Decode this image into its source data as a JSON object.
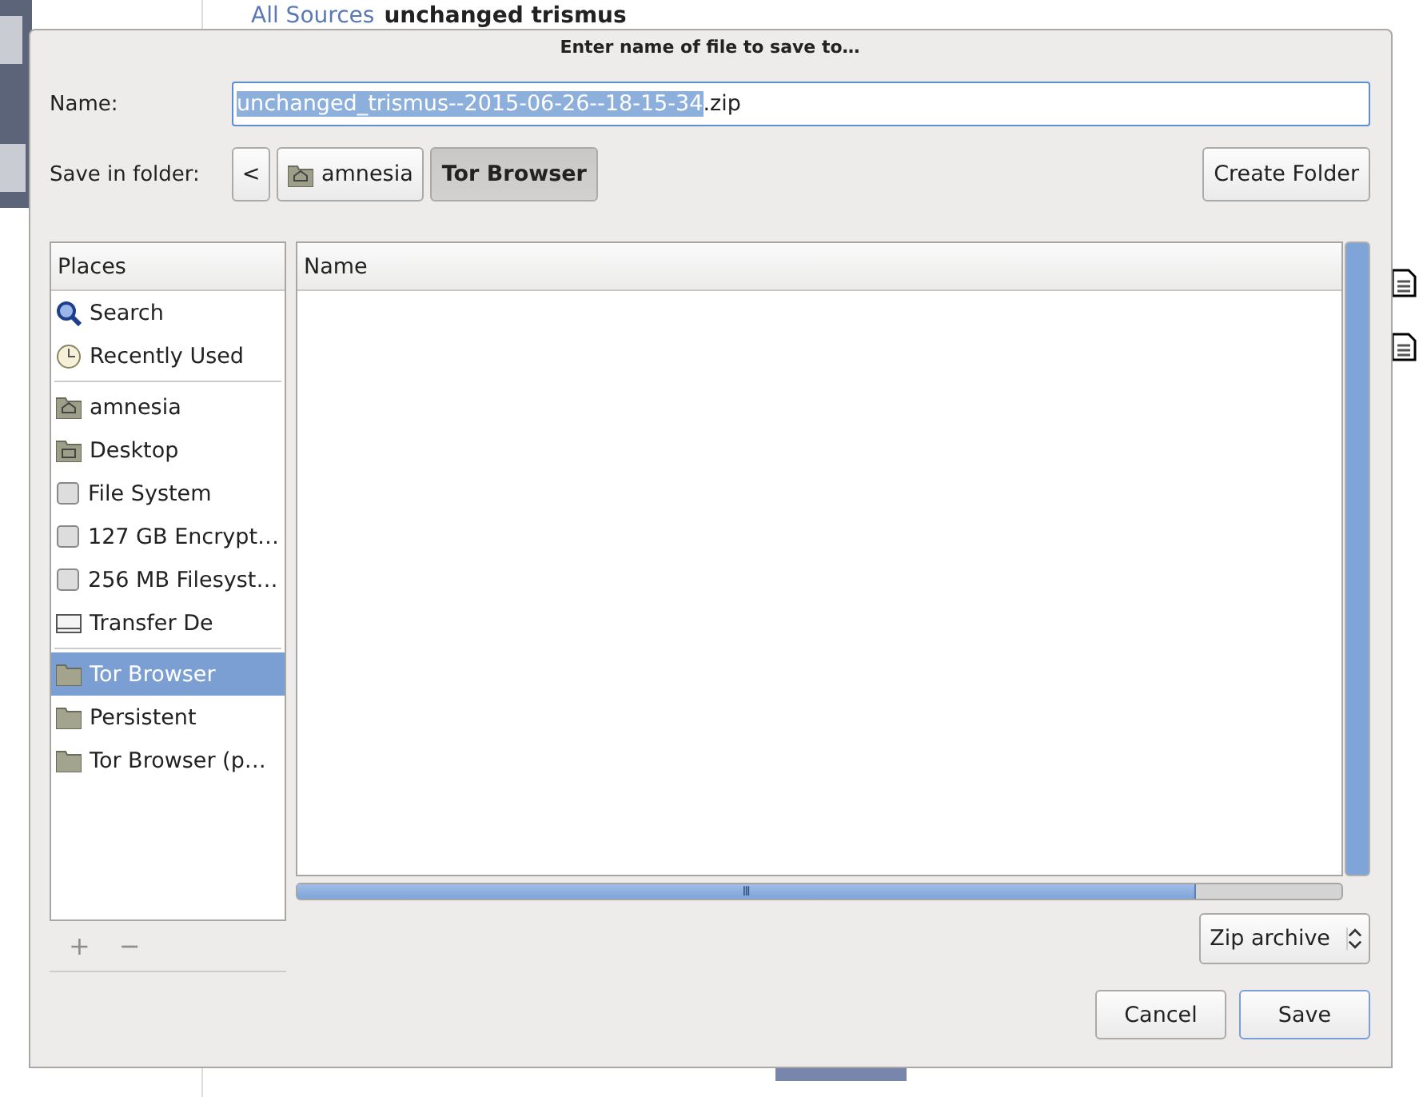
{
  "background": {
    "breadcrumb": [
      {
        "label": "All Sources",
        "kind": "link"
      },
      {
        "label": "unchanged trismus",
        "kind": "current"
      }
    ]
  },
  "dialog": {
    "title": "Enter name of file to save to…",
    "name_label": "Name:",
    "name_selected": "unchanged_trismus--2015-06-26--18-15-34",
    "name_rest": ".zip",
    "folder_label": "Save in folder:",
    "back_symbol": "<",
    "path": [
      {
        "label": "amnesia",
        "kind": "home",
        "selected": false
      },
      {
        "label": "Tor Browser",
        "kind": "plain",
        "selected": true
      }
    ],
    "create_folder": "Create Folder",
    "places": {
      "header": "Places",
      "groups": [
        [
          {
            "label": "Search",
            "kind": "search",
            "selected": false
          },
          {
            "label": "Recently Used",
            "kind": "recent",
            "selected": false
          }
        ],
        [
          {
            "label": "amnesia",
            "kind": "home",
            "selected": false
          },
          {
            "label": "Desktop",
            "kind": "desktop",
            "selected": false
          },
          {
            "label": "File System",
            "kind": "drive",
            "selected": false
          },
          {
            "label": "127 GB Encrypt…",
            "kind": "drive",
            "selected": false
          },
          {
            "label": "256 MB Filesyst…",
            "kind": "drive",
            "selected": false
          },
          {
            "label": "Transfer De",
            "kind": "device",
            "selected": false
          }
        ],
        [
          {
            "label": "Tor Browser",
            "kind": "folder",
            "selected": true
          },
          {
            "label": "Persistent",
            "kind": "folder",
            "selected": false
          },
          {
            "label": "Tor Browser (p…",
            "kind": "folder",
            "selected": false
          }
        ]
      ],
      "add": "+",
      "remove": "−"
    },
    "files": {
      "column": "Name",
      "scroll_symbol": "III"
    },
    "file_type": "Zip archive",
    "buttons": [
      {
        "label": "Cancel",
        "default": false
      },
      {
        "label": "Save",
        "default": true
      }
    ]
  }
}
